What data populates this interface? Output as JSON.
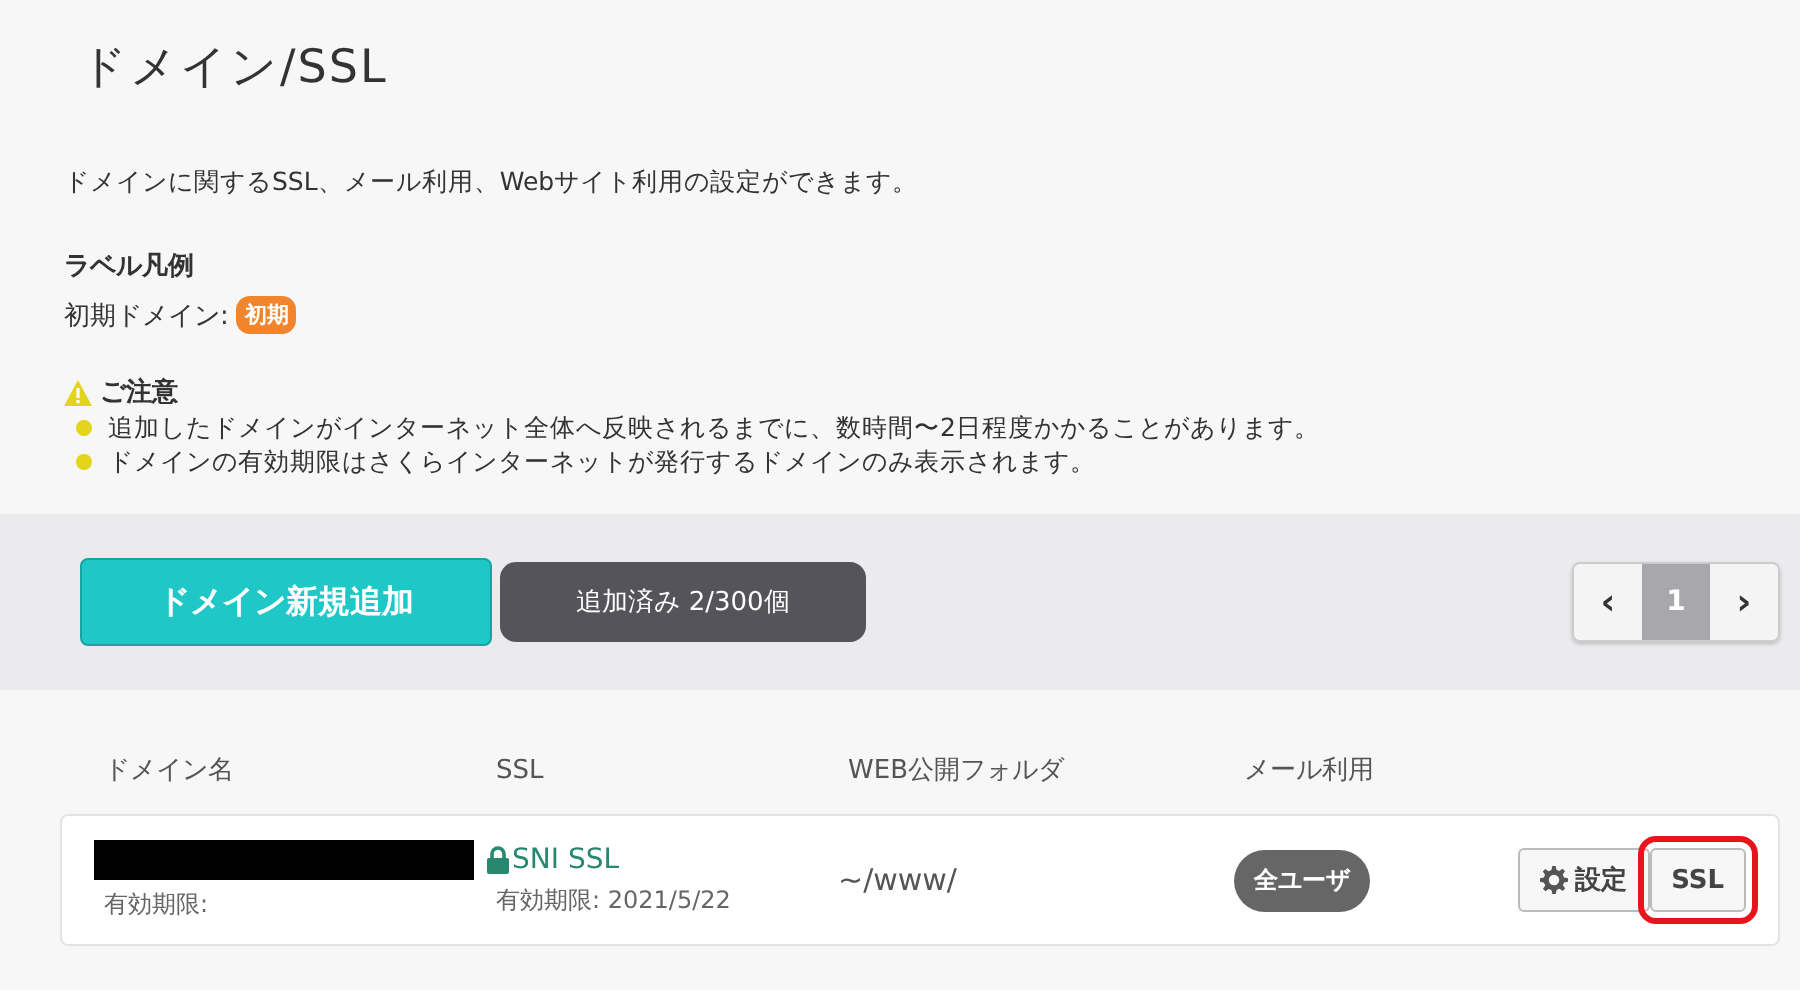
{
  "page": {
    "title": "ドメイン/SSL",
    "description": "ドメインに関するSSL、メール利用、Webサイト利用の設定ができます。"
  },
  "legend": {
    "heading": "ラベル凡例",
    "items": [
      {
        "label": "初期ドメイン:",
        "badge": "初期",
        "color": "#f0852d"
      }
    ]
  },
  "notice": {
    "heading": "ご注意",
    "items": [
      "追加したドメインがインターネット全体へ反映されるまでに、数時間〜2日程度かかることがあります。",
      "ドメインの有効期限はさくらインターネットが発行するドメインのみ表示されます。"
    ]
  },
  "toolbar": {
    "add_button": "ドメイン新規追加",
    "count": "追加済み 2/300個",
    "pagination": {
      "prev": "‹",
      "next": "›",
      "pages": [
        {
          "label": "1",
          "selected": true
        }
      ]
    }
  },
  "table": {
    "columns": [
      "ドメイン名",
      "SSL",
      "WEB公開フォルダ",
      "メール利用"
    ],
    "rows": [
      {
        "domain_redacted": true,
        "domain_expiry": "有効期限:",
        "ssl": "SNI SSL",
        "ssl_expiry": "有効期限: 2021/5/22",
        "folder": "~/www/",
        "mail": "全ユーザ",
        "actions": [
          {
            "kind": "settings",
            "label": "設定",
            "highlighted": false
          },
          {
            "kind": "plain",
            "label": "SSL",
            "highlighted": true
          }
        ]
      }
    ]
  }
}
